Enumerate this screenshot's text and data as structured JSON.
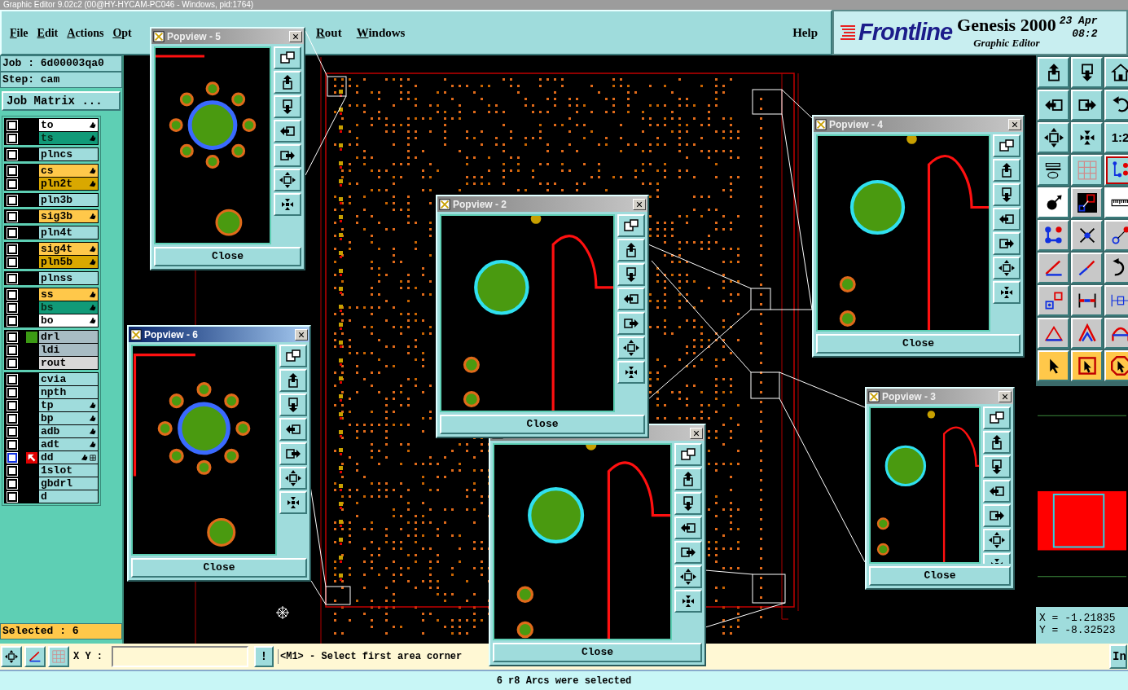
{
  "window": {
    "title": "Graphic Editor 9.02c2 (00@HY-HYCAM-PC046 - Windows, pid:1764)"
  },
  "menu": {
    "items": [
      "File",
      "Edit",
      "Actions",
      "Opt"
    ],
    "items_right_of_popup": [
      "Rout",
      "Windows"
    ],
    "help": "Help"
  },
  "brand": {
    "logo": "Frontline",
    "product": "Genesis 2000",
    "subtitle": "Graphic Editor",
    "date": "23 Apr",
    "time": "08:2"
  },
  "job_panel": {
    "job": "Job : 6d00003qa0",
    "step": "Step: cam",
    "matrix_button": "Job Matrix ..."
  },
  "layer_groups": [
    {
      "layers": [
        {
          "name": "to",
          "color": "#ffffff",
          "checked": false,
          "flagged": true,
          "work_layer": false
        },
        {
          "name": "ts",
          "color": "#119a78",
          "checked": false,
          "flagged": true,
          "work_layer": false
        }
      ]
    },
    {
      "layers": [
        {
          "name": "plncs",
          "color": "#9fdcdc",
          "checked": false,
          "flagged": false,
          "work_layer": false
        }
      ]
    },
    {
      "layers": [
        {
          "name": "cs",
          "color": "#ffc84a",
          "checked": false,
          "flagged": true,
          "work_layer": false
        },
        {
          "name": "pln2t",
          "color": "#d9a800",
          "checked": false,
          "flagged": true,
          "work_layer": false
        }
      ]
    },
    {
      "layers": [
        {
          "name": "pln3b",
          "color": "#9fdcdc",
          "checked": false,
          "flagged": false,
          "work_layer": false
        }
      ]
    },
    {
      "layers": [
        {
          "name": "sig3b",
          "color": "#ffc84a",
          "checked": false,
          "flagged": true,
          "work_layer": false
        }
      ]
    },
    {
      "layers": [
        {
          "name": "pln4t",
          "color": "#9fdcdc",
          "checked": false,
          "flagged": false,
          "work_layer": false
        }
      ]
    },
    {
      "layers": [
        {
          "name": "sig4t",
          "color": "#ffc84a",
          "checked": false,
          "flagged": true,
          "work_layer": false
        },
        {
          "name": "pln5b",
          "color": "#d9a800",
          "checked": false,
          "flagged": true,
          "work_layer": false
        }
      ]
    },
    {
      "layers": [
        {
          "name": "plnss",
          "color": "#9fdcdc",
          "checked": false,
          "flagged": false,
          "work_layer": false
        }
      ]
    },
    {
      "layers": [
        {
          "name": "ss",
          "color": "#ffc84a",
          "checked": false,
          "flagged": true,
          "work_layer": false
        },
        {
          "name": "bs",
          "color": "#119a78",
          "checked": false,
          "flagged": true,
          "work_layer": false
        },
        {
          "name": "bo",
          "color": "#ffffff",
          "checked": false,
          "flagged": true,
          "work_layer": false
        }
      ]
    },
    {
      "layers": [
        {
          "name": "drl",
          "color": "#a8bcc4",
          "checked": false,
          "flagged": false,
          "work_layer": false,
          "swatch": {
            "color": "#3c9a14"
          }
        },
        {
          "name": "ldi",
          "color": "#a8bcc4",
          "checked": false,
          "flagged": false,
          "work_layer": false
        },
        {
          "name": "rout",
          "color": "#d8d8d8",
          "checked": false,
          "flagged": false,
          "work_layer": false
        }
      ]
    },
    {
      "layers": [
        {
          "name": "cvia",
          "color": "#9fdcdc",
          "checked": false,
          "flagged": false,
          "work_layer": false
        },
        {
          "name": "npth",
          "color": "#9fdcdc",
          "checked": false,
          "flagged": false,
          "work_layer": false
        },
        {
          "name": "tp",
          "color": "#9fdcdc",
          "checked": false,
          "flagged": true,
          "work_layer": false
        },
        {
          "name": "bp",
          "color": "#9fdcdc",
          "checked": false,
          "flagged": true,
          "work_layer": false
        },
        {
          "name": "adb",
          "color": "#9fdcdc",
          "checked": false,
          "flagged": true,
          "work_layer": false
        },
        {
          "name": "adt",
          "color": "#9fdcdc",
          "checked": false,
          "flagged": true,
          "work_layer": false
        },
        {
          "name": "dd",
          "color": "#9fdcdc",
          "checked": false,
          "flagged": true,
          "work_layer": true
        },
        {
          "name": "1slot",
          "color": "#9fdcdc",
          "checked": false,
          "flagged": false,
          "work_layer": false
        },
        {
          "name": "gbdrl",
          "color": "#9fdcdc",
          "checked": false,
          "flagged": false,
          "work_layer": false
        },
        {
          "name": "d",
          "color": "#9fdcdc",
          "checked": false,
          "flagged": false,
          "work_layer": false
        }
      ]
    }
  ],
  "selected_count": "Selected : 6",
  "right_panel": {
    "zoom_ratio": "1:2",
    "coordinates": [
      "X = -1.21835",
      "Y = -8.32523"
    ]
  },
  "popviews": [
    {
      "title": "Popview - 5",
      "active": false,
      "close_label": "Close"
    },
    {
      "close_label": "Close",
      "active": false
    },
    {
      "title": "Popview - 2",
      "active": false,
      "close_label": "Close"
    },
    {
      "title": "Popview - 4",
      "active": false,
      "close_label": "Close"
    },
    {
      "title": "Popview - 6",
      "active": true,
      "close_label": "Close"
    },
    {
      "title": "Popview - 3",
      "active": false,
      "close_label": "Close"
    }
  ],
  "command_bar": {
    "xy_label": "X Y :",
    "alert_button": "!",
    "prompt": "<M1> - Select first area corner",
    "right_button": "In"
  },
  "status_bar": "6 r8 Arcs were selected"
}
